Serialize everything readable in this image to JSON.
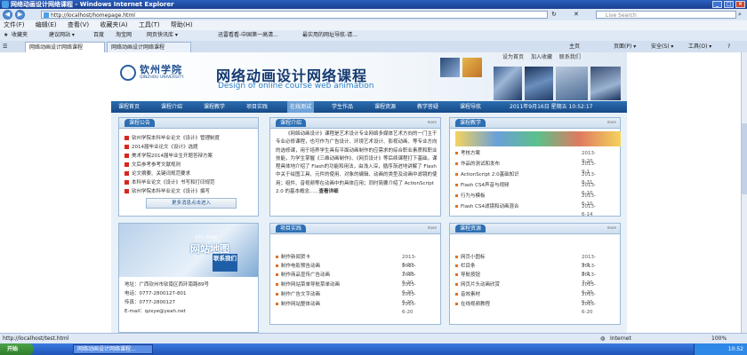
{
  "window": {
    "title": "网络动画设计网络课程 - Windows Internet Explorer"
  },
  "address": {
    "url": "http://localhost/homepage.html",
    "search_placeholder": "Live Search"
  },
  "menu": [
    "文件(F)",
    "编辑(E)",
    "查看(V)",
    "收藏夹(A)",
    "工具(T)",
    "帮助(H)"
  ],
  "favbar": {
    "favorites": "收藏夹",
    "items": [
      "建议网站 ▾",
      "百度",
      "淘宝网",
      "网页快讯库 ▾",
      "迅雷看看-中国第一高清...",
      "最实用的网址导航-请..."
    ]
  },
  "tabs": {
    "tab1": "网络动画设计网络课程",
    "tab2": "网络动画设计网络课程",
    "tools": [
      "主页",
      "页面(P) ▾",
      "安全(S) ▾",
      "工具(O) ▾",
      "?"
    ]
  },
  "site": {
    "logo_cn": "钦州学院",
    "logo_en": "QINZHOU UNIVERSITY",
    "title": "网络动画设计网络课程",
    "subtitle": "Design of online course web animation",
    "toplinks": [
      "设为首页",
      "加入收藏",
      "联系我们"
    ],
    "nav": [
      "课程首页",
      "课程介绍",
      "课程教学",
      "项目实践",
      "在线测试",
      "学生作品",
      "课程资源",
      "教学答疑",
      "课程导航"
    ],
    "date": "2011年9月16日 星期五 10:52:17"
  },
  "notice": {
    "title": "课程公告",
    "items": [
      "钦州学院本科毕业论文《设计》管理制度",
      "2014届毕业论文《设计》选题",
      "美术学院2014届毕业生开题答辩方案",
      "文后参考参考文献规则",
      "论文摘要、关键词规范要求",
      "本科毕业论文《设计》书写和打印规范",
      "钦州学院本科毕业论文《设计》撰写"
    ],
    "more_button": "更多消息点击进入"
  },
  "sitemap": {
    "label_en": "sits map",
    "label_cn": "网站地图",
    "contact": "联系我们"
  },
  "contact": {
    "address": "地址：广西钦州市钦南区西环南路89号",
    "phone": "电话：0777-2800127-801",
    "fax": "传真：0777-2800127",
    "email": "E-mail：qzxye@yeah.net"
  },
  "intro": {
    "title": "课程介绍",
    "more": "more",
    "text": "《网络动画设计》课程是艺术设计专业网络多媒体艺术方向的一门主干专业必修课程，也可作为广告设计、环境艺术设计、影视动画、等专业方向的选修课，用于培养学生具有平面动画制作的应需求的综合职业素质和职业技能，为学生掌握《三维动画制作》、《网页设计》等后续课程打下基础。课程具体地介绍了 Flash的功能和用法，由浅入深，循序渐进地讲解了 Flash中关于绘图工具、元件的使用、对象的编辑、动画的类型及动画中滤镜的使用；组件、音视频等在动画中的具体应用；同时简要介绍了 ActionScript 2.0 的基本概念......",
    "detail": "查看详细"
  },
  "teaching": {
    "title": "课程教学",
    "more": "more",
    "items": [
      {
        "t": "考核方案",
        "d": "2013-9-20"
      },
      {
        "t": "作品的测试和发布",
        "d": "2013-9-1"
      },
      {
        "t": "ActionScript 2.0基础知识",
        "d": "2013-8-31"
      },
      {
        "t": "Flash CS4声音与视频",
        "d": "2013-6-10"
      },
      {
        "t": "行为与模板",
        "d": "2013-6-10"
      },
      {
        "t": "Flash CS4滤镜和动画混合",
        "d": "2013-6-14"
      }
    ]
  },
  "projects": {
    "title": "项目实践",
    "more": "more",
    "items": [
      {
        "t": "制作新闻贺卡",
        "d": "2013-6-20"
      },
      {
        "t": "制作电影预告动画",
        "d": "2013-7-28"
      },
      {
        "t": "制作商品宣传广告动画",
        "d": "2013-6-20"
      },
      {
        "t": "制作网站菜单导航菜单动画",
        "d": "2013-6-20"
      },
      {
        "t": "制作广告文字动画",
        "d": "2013-6-20"
      },
      {
        "t": "制作网站整体动画",
        "d": "2013-6-20"
      }
    ]
  },
  "resources": {
    "title": "课程资源",
    "more": "more",
    "items": [
      {
        "t": "网页小图标",
        "d": "2013-9-1"
      },
      {
        "t": "栏目条",
        "d": "2013-8-1"
      },
      {
        "t": "导航按钮",
        "d": "2013-7-20"
      },
      {
        "t": "网页片头动画欣赏",
        "d": "2013-6-20"
      },
      {
        "t": "音效素材",
        "d": "2013-6-20"
      },
      {
        "t": "在线视频教程",
        "d": "2013-6-20"
      }
    ]
  },
  "status": {
    "url": "http://localhost/test.html",
    "zone": "Internet",
    "zoom": "100%"
  },
  "taskbar": {
    "start": "开始",
    "task": "网络动画设计网络课程...",
    "time": "10:52"
  }
}
